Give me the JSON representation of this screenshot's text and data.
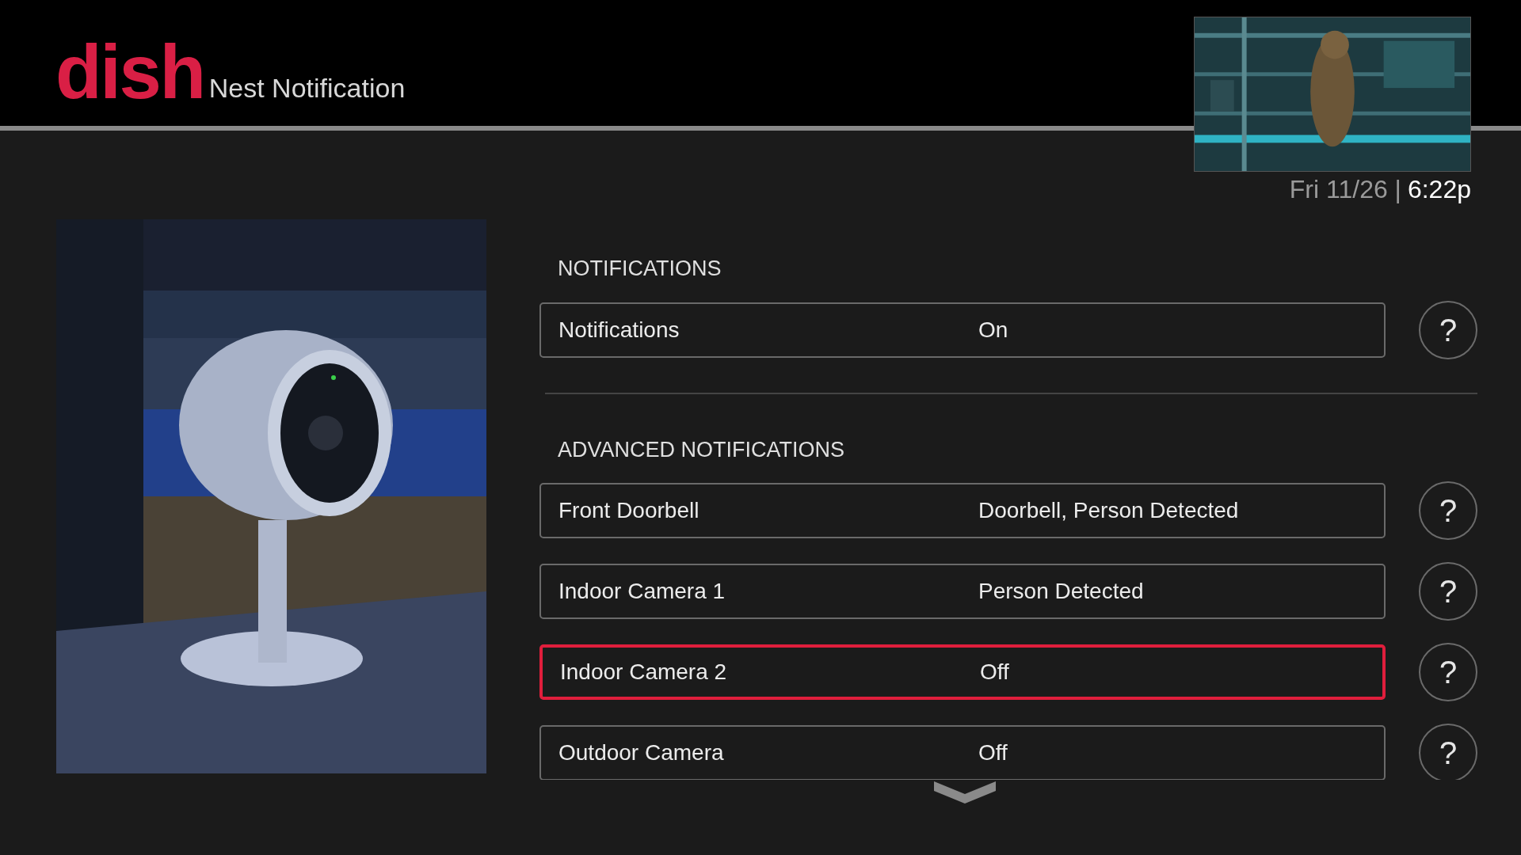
{
  "header": {
    "logo": "dish",
    "title": "Nest Notification"
  },
  "clock": {
    "date": "Fri 11/26 |",
    "time": "6:22p"
  },
  "sections": [
    {
      "title": "NOTIFICATIONS",
      "rows": [
        {
          "label": "Notifications",
          "value": "On",
          "selected": false
        }
      ]
    },
    {
      "title": "ADVANCED NOTIFICATIONS",
      "rows": [
        {
          "label": "Front Doorbell",
          "value": "Doorbell, Person Detected",
          "selected": false
        },
        {
          "label": "Indoor Camera 1",
          "value": "Person Detected",
          "selected": false
        },
        {
          "label": "Indoor Camera 2",
          "value": "Off",
          "selected": true
        },
        {
          "label": "Outdoor Camera",
          "value": "Off",
          "selected": false
        }
      ]
    }
  ],
  "help_label": "?"
}
